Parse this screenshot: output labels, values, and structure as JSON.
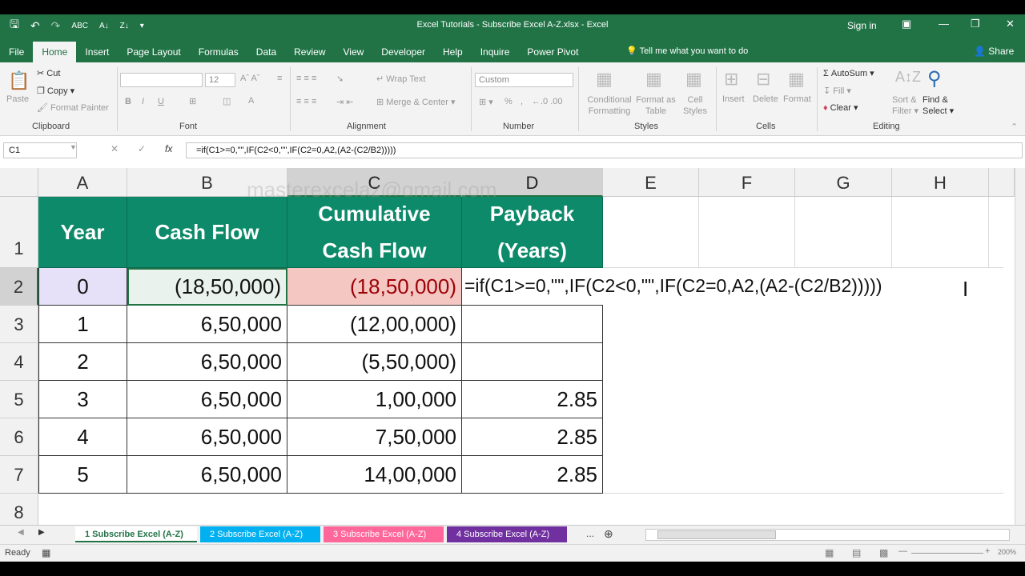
{
  "window": {
    "title": "Excel Tutorials - Subscribe Excel A-Z.xlsx  -  Excel",
    "sign_in": "Sign in",
    "share": "Share",
    "tell_me": "Tell me what you want to do"
  },
  "tabs": [
    "File",
    "Home",
    "Insert",
    "Page Layout",
    "Formulas",
    "Data",
    "Review",
    "View",
    "Developer",
    "Help",
    "Inquire",
    "Power Pivot"
  ],
  "active_tab": "Home",
  "ribbon": {
    "clipboard": {
      "label": "Clipboard",
      "paste": "Paste",
      "cut": "Cut",
      "copy": "Copy",
      "format_painter": "Format Painter"
    },
    "font": {
      "label": "Font",
      "font_size": "12"
    },
    "alignment": {
      "label": "Alignment",
      "wrap_text": "Wrap Text",
      "merge_center": "Merge & Center"
    },
    "number": {
      "label": "Number",
      "format": "Custom"
    },
    "styles": {
      "label": "Styles",
      "conditional": "Conditional",
      "formatting": "Formatting",
      "format_as": "Format as",
      "table": "Table",
      "cell": "Cell",
      "styles_btn": "Styles"
    },
    "cells": {
      "label": "Cells",
      "insert": "Insert",
      "delete": "Delete",
      "format": "Format"
    },
    "editing": {
      "label": "Editing",
      "autosum": "AutoSum",
      "fill": "Fill",
      "clear": "Clear",
      "sort": "Sort &",
      "filter": "Filter",
      "find": "Find &",
      "select": "Select"
    }
  },
  "formula_bar": {
    "name_box": "C1",
    "formula": "=if(C1>=0,\"\",IF(C2<0,\"\",IF(C2=0,A2,(A2-(C2/B2)))))"
  },
  "watermark": "masterexcelaz@gmail.com",
  "columns": [
    "A",
    "B",
    "C",
    "D",
    "E",
    "F",
    "G",
    "H"
  ],
  "rows": [
    "1",
    "2",
    "3",
    "4",
    "5",
    "6",
    "7",
    "8"
  ],
  "headers": {
    "year": "Year",
    "cash_flow": "Cash Flow",
    "cumulative_1": "Cumulative",
    "cumulative_2": "Cash Flow",
    "payback_1": "Payback",
    "payback_2": "(Years)"
  },
  "table_rows": [
    {
      "year": "0",
      "cash_flow": "(18,50,000)",
      "cumulative": "(18,50,000)",
      "payback": ""
    },
    {
      "year": "1",
      "cash_flow": "6,50,000",
      "cumulative": "(12,00,000)",
      "payback": ""
    },
    {
      "year": "2",
      "cash_flow": "6,50,000",
      "cumulative": "(5,50,000)",
      "payback": ""
    },
    {
      "year": "3",
      "cash_flow": "6,50,000",
      "cumulative": "1,00,000",
      "payback": "2.85"
    },
    {
      "year": "4",
      "cash_flow": "6,50,000",
      "cumulative": "7,50,000",
      "payback": "2.85"
    },
    {
      "year": "5",
      "cash_flow": "6,50,000",
      "cumulative": "14,00,000",
      "payback": "2.85"
    }
  ],
  "edit_cell_text": "=if(C1>=0,\"\",IF(C2<0,\"\",IF(C2=0,A2,(A2-(C2/B2)))))",
  "sheet_tabs": [
    {
      "label": "1 Subscribe Excel (A-Z)",
      "color": "#ffffff"
    },
    {
      "label": "2 Subscribe Excel (A-Z)",
      "color": "#00b0f0"
    },
    {
      "label": "3 Subscribe Excel (A-Z)",
      "color": "#ff6699"
    },
    {
      "label": "4 Subscribe Excel (A-Z)",
      "color": "#7030a0"
    }
  ],
  "status": {
    "ready": "Ready",
    "zoom": "200%"
  },
  "colors": {
    "excel_green": "#217346",
    "header_fill": "#0d8a6a",
    "error_fill": "#f4c7c3",
    "selected_row": "#e6e0f8"
  }
}
